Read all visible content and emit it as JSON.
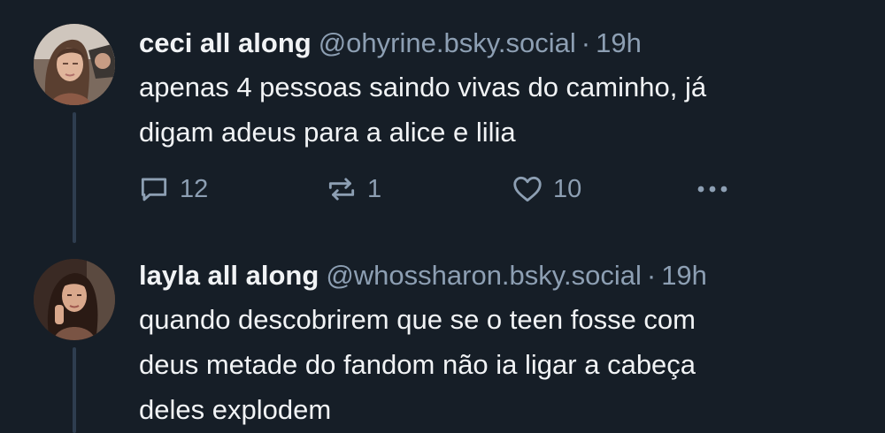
{
  "posts": [
    {
      "author": {
        "display_name": "ceci all along",
        "handle": "@ohyrine.bsky.social"
      },
      "separator": "·",
      "time": "19h",
      "text": "apenas 4 pessoas saindo vivas do caminho, já\ndigam adeus para a alice e lilia",
      "stats": {
        "replies": "12",
        "reposts": "1",
        "likes": "10"
      },
      "icons": {
        "reply": "reply-bubble-icon",
        "repost": "repost-arrows-icon",
        "like": "heart-icon",
        "more": "more-dots-icon"
      }
    },
    {
      "author": {
        "display_name": "layla all along",
        "handle": "@whossharon.bsky.social"
      },
      "separator": "·",
      "time": "19h",
      "text": "quando descobrirem que se o teen fosse com\ndeus metade do fandom não ia ligar a cabeça\ndeles explodem"
    }
  ],
  "colors": {
    "background": "#161e27",
    "text_primary": "#f1f3f5",
    "text_secondary": "#8d9fb3",
    "thread_line": "#2e3d4f"
  }
}
